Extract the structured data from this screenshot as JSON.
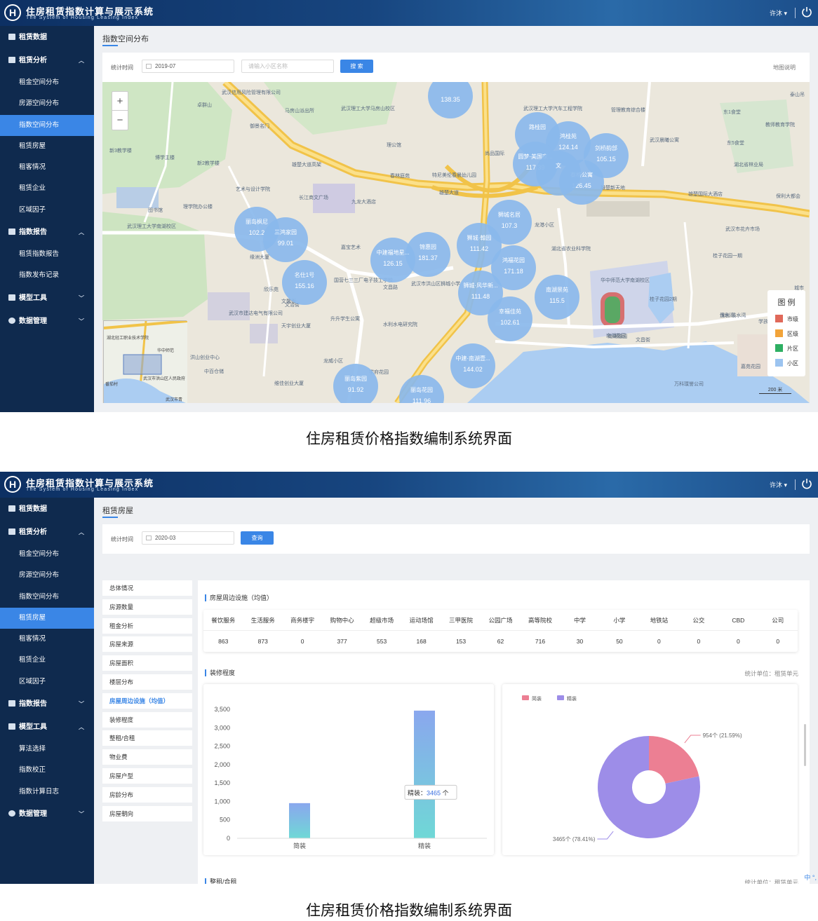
{
  "app": {
    "title": "住房租赁指数计算与展示系统",
    "subtitle": "The System of Housing Leasing Index",
    "logo_letter": "H",
    "user": "许沐",
    "user_caret": "▾"
  },
  "nav1": {
    "g0": "租赁数据",
    "g1": "租赁分析",
    "i1": "租金空间分布",
    "i2": "房源空间分布",
    "i3": "指数空间分布",
    "i4": "租赁房屋",
    "i5": "租客情况",
    "i6": "租赁企业",
    "i7": "区域因子",
    "g2": "指数报告",
    "i8": "租赁指数报告",
    "i9": "指数发布记录",
    "g3": "模型工具",
    "g4": "数据管理",
    "active": "指数空间分布"
  },
  "nav2": {
    "g0": "租赁数据",
    "g1": "租赁分析",
    "i1": "租金空间分布",
    "i2": "房源空间分布",
    "i3": "指数空间分布",
    "i4": "租赁房屋",
    "i5": "租客情况",
    "i6": "租赁企业",
    "i7": "区域因子",
    "g2": "指数报告",
    "g3": "模型工具",
    "i8": "算法选择",
    "i9": "指数校正",
    "i10": "指数计算日志",
    "g4": "数据管理",
    "active": "租赁房屋"
  },
  "screen1": {
    "page_title": "指数空间分布",
    "filter_label": "统计时间",
    "date": "2019-07",
    "search_placeholder": "请输入小区名称",
    "search_button": "搜 索",
    "map_link": "地图说明",
    "zoom_in": "+",
    "zoom_out": "−",
    "legend_title": "图 例",
    "legend": [
      {
        "label": "市级",
        "color": "#e0695a"
      },
      {
        "label": "区级",
        "color": "#f2a43a"
      },
      {
        "label": "片区",
        "color": "#2eaf62"
      },
      {
        "label": "小区",
        "color": "#9cc4f0"
      }
    ],
    "scale": "200 米",
    "bubbles": [
      {
        "name": "",
        "value": "138.35"
      },
      {
        "name": "鸿桂苑",
        "value": "124.14"
      },
      {
        "name": "路桂园",
        "value": ""
      },
      {
        "name": "圆梦·美国家...",
        "value": "117.39"
      },
      {
        "name": "剑桥韵部",
        "value": "105.15"
      },
      {
        "name": "泰格公寓",
        "value": "126.45"
      },
      {
        "name": "文",
        "value": ""
      },
      {
        "name": "狮城名居",
        "value": "107.3"
      },
      {
        "name": "丽岛枫尼",
        "value": "102.2"
      },
      {
        "name": "三鸿家园",
        "value": "99.01"
      },
      {
        "name": "锦惠园",
        "value": "181.37"
      },
      {
        "name": "中建福地星...",
        "value": "126.15"
      },
      {
        "name": "狮城·翰园",
        "value": "111.42"
      },
      {
        "name": "鸿福花园",
        "value": "171.18"
      },
      {
        "name": "名仕1号",
        "value": "155.16"
      },
      {
        "name": "狮城·风华新...",
        "value": "111.48"
      },
      {
        "name": "南湖景苑",
        "value": "115.5"
      },
      {
        "name": "幸福佳苑",
        "value": "102.61"
      },
      {
        "name": "中建·南湖壹...",
        "value": "144.02"
      },
      {
        "name": "丽岛紫园",
        "value": "91.92"
      },
      {
        "name": "丽岛花园",
        "value": "111.96"
      }
    ],
    "places": [
      {
        "t": "武汉理工大学南湖校区"
      },
      {
        "t": "武汉理工大学马房山校区"
      },
      {
        "t": "雄楚大道高架"
      },
      {
        "t": "雄楚大道"
      },
      {
        "t": "文治街"
      },
      {
        "t": "文昌路"
      },
      {
        "t": "华中师范大学南湖校区"
      },
      {
        "t": "南湖雅园"
      },
      {
        "t": "艺术与设计学院"
      },
      {
        "t": "长江商文广场"
      },
      {
        "t": "九龙大酒店"
      },
      {
        "t": "武汉信用风险管理有限公司"
      },
      {
        "t": "马房山派出所"
      },
      {
        "t": "图书馆"
      },
      {
        "t": "理学院办公楼"
      },
      {
        "t": "卓群山"
      },
      {
        "t": "新3教学楼"
      },
      {
        "t": "博学主楼"
      },
      {
        "t": "新2教学楼"
      },
      {
        "t": "文馨街"
      },
      {
        "t": "欣乐苑"
      },
      {
        "t": "天宇创业大厦"
      },
      {
        "t": "升升学生公寓"
      },
      {
        "t": "水利水电研究院"
      },
      {
        "t": "国营七三三厂电子技工学校"
      },
      {
        "t": "武汉市洪山区狮城小学"
      },
      {
        "t": "龙港小区"
      },
      {
        "t": "湖北省农业科学院"
      },
      {
        "t": "武汉晨曦公寓"
      },
      {
        "t": "湖北省林业局"
      },
      {
        "t": "桂子花园一期"
      },
      {
        "t": "桂子花园2期"
      },
      {
        "t": "保利·浅水湾"
      },
      {
        "t": "武汉市花卉市场"
      },
      {
        "t": "雄楚国际大酒店"
      },
      {
        "t": "保利大都会"
      },
      {
        "t": "万科璞誉公司"
      },
      {
        "t": "嘉宝艺术"
      },
      {
        "t": "龙威小区"
      },
      {
        "t": "东1食堂"
      },
      {
        "t": "东5食堂"
      },
      {
        "t": "教师教育学院"
      },
      {
        "t": "管理教育综合楼"
      },
      {
        "t": "武汉理工大学汽车工程学院"
      },
      {
        "t": "尚品国际"
      },
      {
        "t": "特尼美伦春晨幼儿园"
      },
      {
        "t": "春林庭苑"
      },
      {
        "t": "理公馆"
      },
      {
        "t": "御景名门"
      },
      {
        "t": "中百仓储"
      },
      {
        "t": "洪山创业中心"
      },
      {
        "t": "缘洲大厦"
      },
      {
        "t": "武汉市建达电气有限公司"
      },
      {
        "t": "雄楚新天地"
      },
      {
        "t": "南湖花园"
      },
      {
        "t": "文昌街"
      },
      {
        "t": "维佳创业大厦"
      },
      {
        "t": "学府花园"
      },
      {
        "t": "嘉苑花园"
      },
      {
        "t": "浅水湾"
      },
      {
        "t": "学孩苑"
      },
      {
        "t": "城市"
      },
      {
        "t": "泰山吊"
      }
    ],
    "overview_labels": [
      "湖北轻工职业技术学院",
      "武汉市洪山区人民政府",
      "华中师范",
      "番茄村",
      "武汉市青"
    ]
  },
  "screen2": {
    "page_title": "租赁房屋",
    "filter_label": "统计时间",
    "date": "2020-03",
    "query_button": "查询",
    "submenu": [
      "总体情况",
      "房源数量",
      "租金分析",
      "房屋来源",
      "房屋面积",
      "楼层分布",
      "房屋周边设施（均值）",
      "装修程度",
      "整租/合租",
      "物业费",
      "房屋户型",
      "房龄分布",
      "房屋朝向"
    ],
    "submenu_active": "房屋周边设施（均值）",
    "facilities_title": "房屋周边设施（均值）",
    "facilities": {
      "headers": [
        "餐饮服务",
        "生活服务",
        "商务楼宇",
        "购物中心",
        "超级市场",
        "运动场馆",
        "三甲医院",
        "公园广场",
        "高等院校",
        "中学",
        "小学",
        "地铁站",
        "公交",
        "CBD",
        "公司"
      ],
      "values": [
        "863",
        "873",
        "0",
        "377",
        "553",
        "168",
        "153",
        "62",
        "716",
        "30",
        "50",
        "0",
        "0",
        "0",
        "0"
      ]
    },
    "decoration_title": "装修程度",
    "decoration_unit": "统计单位：租赁单元",
    "rent_title": "整租/合租",
    "rent_unit": "统计单位：租赁单元",
    "tooltip_label": "精装：",
    "tooltip_value": "3465",
    "tooltip_unit": " 个",
    "pie_label_a": "954个 (21.59%)",
    "pie_label_b": "3465个 (78.41%)",
    "ime": "中 °,"
  },
  "chart_data": [
    {
      "type": "bar",
      "categories": [
        "简装",
        "精装"
      ],
      "values": [
        954,
        3465
      ],
      "ylim": [
        0,
        3500
      ],
      "yticks": [
        0,
        500,
        1000,
        1500,
        2000,
        2500,
        3000,
        3500
      ],
      "ytick_labels": [
        "0",
        "500",
        "1,000",
        "1,500",
        "2,000",
        "2,500",
        "3,000",
        "3,500"
      ],
      "title": "",
      "xlabel": "",
      "ylabel": ""
    },
    {
      "type": "pie",
      "categories": [
        "简装",
        "精装"
      ],
      "values": [
        954,
        3465
      ],
      "percent": [
        21.59,
        78.41
      ],
      "colors": [
        "#ec7f93",
        "#9d8de8"
      ],
      "legend": [
        "简装",
        "精装"
      ]
    }
  ],
  "captions": {
    "top": "住房租赁价格指数编制系统界面",
    "bottom": "住房租赁价格指数编制系统界面"
  }
}
